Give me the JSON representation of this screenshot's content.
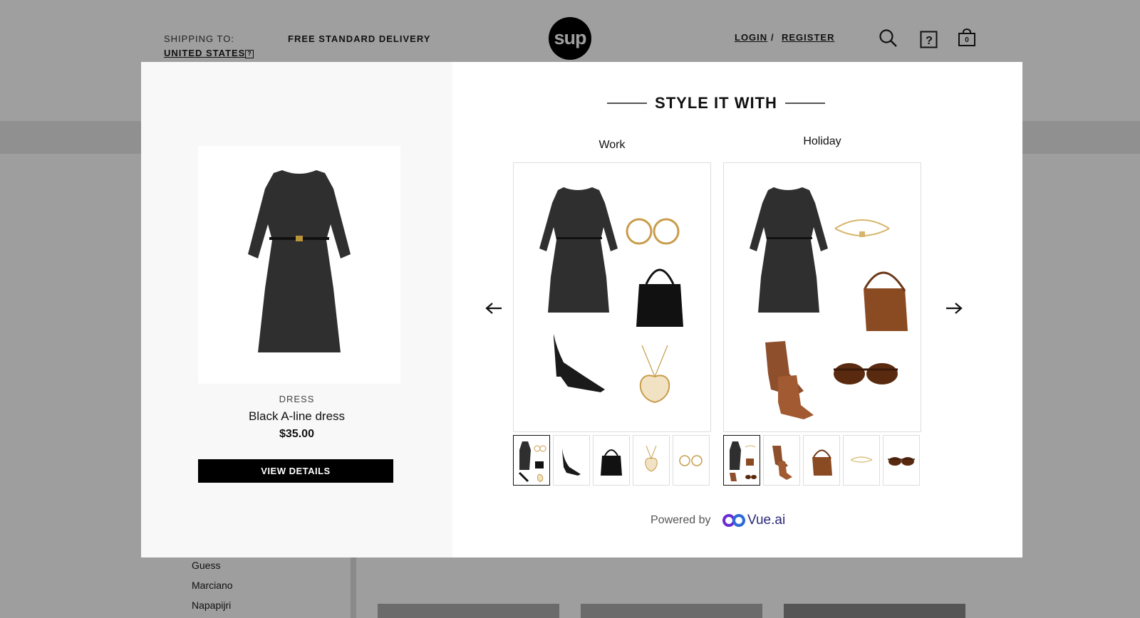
{
  "header": {
    "shipping_label": "SHIPPING TO:",
    "shipping_country": "UNITED STATES",
    "help_icon": "?",
    "free_delivery": "FREE STANDARD DELIVERY",
    "logo_text": "sup",
    "login": "LOGIN",
    "separator": "/",
    "register": "REGISTER",
    "cart_count": "0",
    "icons": [
      "search-icon",
      "help-icon",
      "cart-icon"
    ]
  },
  "sidebar": {
    "brands": [
      "Guess",
      "Marciano",
      "Napapijri"
    ]
  },
  "modal": {
    "product": {
      "category": "DRESS",
      "name": "Black A-line dress",
      "price": "$35.00",
      "view_details": "VIEW DETAILS"
    },
    "style_title": "STYLE IT WITH",
    "looks": [
      {
        "label": "Work",
        "items": [
          "black dress",
          "gold hoop earrings",
          "black handbag",
          "black pumps",
          "gold heart necklace"
        ]
      },
      {
        "label": "Holiday",
        "items": [
          "black dress",
          "gold bangle",
          "brown crossbody bag",
          "brown ankle boots",
          "brown sunglasses"
        ]
      }
    ],
    "nav": [
      "arrow-left-icon",
      "arrow-right-icon"
    ],
    "powered_by": "Powered by",
    "vendor": "Vue.ai"
  },
  "colors": {
    "overlay": "#9e9e9e",
    "accent": "#000000",
    "vue_purple": "#6a2bd6",
    "vue_blue": "#2c6bd6"
  }
}
